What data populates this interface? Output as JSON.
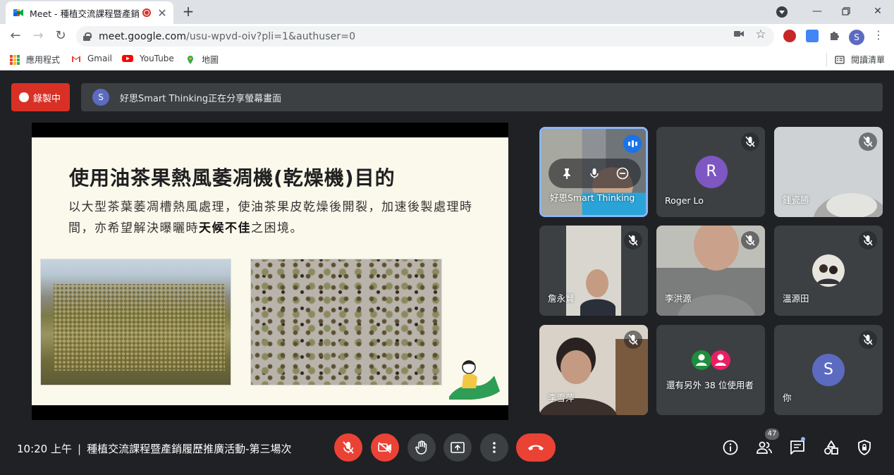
{
  "browser": {
    "tab_title": "Meet - 種植交流課程暨產銷",
    "tab_close": "✕",
    "new_tab": "+",
    "url_host": "meet.google.com",
    "url_path": "/usu-wpvd-oiv?pli=1&authuser=0",
    "profile_initial": "S",
    "bookmarks": [
      {
        "label": "應用程式",
        "icon": "apps-grid-icon"
      },
      {
        "label": "Gmail",
        "icon": "gmail-icon"
      },
      {
        "label": "YouTube",
        "icon": "youtube-icon"
      },
      {
        "label": "地圖",
        "icon": "maps-pin-icon"
      }
    ],
    "reading_list": "閱讀清單"
  },
  "meet": {
    "recording_label": "錄製中",
    "presenter_initial": "S",
    "sharing_notice": "好思Smart Thinking正在分享螢幕畫面",
    "slide": {
      "title": "使用油茶果熱風萎凋機(乾燥機)目的",
      "body_before": "以大型茶葉萎凋槽熱風處理，使油茶果皮乾燥後開裂，加速後製處理時間，亦希望解決曝曬時",
      "body_bold": "天候不佳",
      "body_after": "之困境。"
    },
    "participants": [
      {
        "name": "好思Smart Thinking",
        "state": "speaking-pinned"
      },
      {
        "name": "Roger Lo",
        "initial": "R",
        "avatar_color": "#7e57c2",
        "muted": true
      },
      {
        "name": "鍾瓷勝",
        "muted": true
      },
      {
        "name": "詹永賢",
        "muted": true
      },
      {
        "name": "李洪源",
        "muted": true
      },
      {
        "name": "溫源田",
        "muted": true
      },
      {
        "name": "李雪萍",
        "muted": true
      },
      {
        "name": "還有另外 38 位使用者",
        "state": "overflow"
      },
      {
        "name": "你",
        "initial": "S",
        "avatar_color": "#5c6bc0",
        "muted": true
      }
    ],
    "clock": "10:20 上午",
    "separator": "|",
    "meeting_title": "種植交流課程暨產銷履歷推廣活動-第三場次",
    "participant_count": "47",
    "colors": {
      "accent_red": "#ea4335",
      "recording_red": "#d93025",
      "tile_bg": "#3c4043",
      "page_bg": "#202124",
      "active_border": "#8ab4f8",
      "speaking_blue": "#1a73e8"
    }
  }
}
